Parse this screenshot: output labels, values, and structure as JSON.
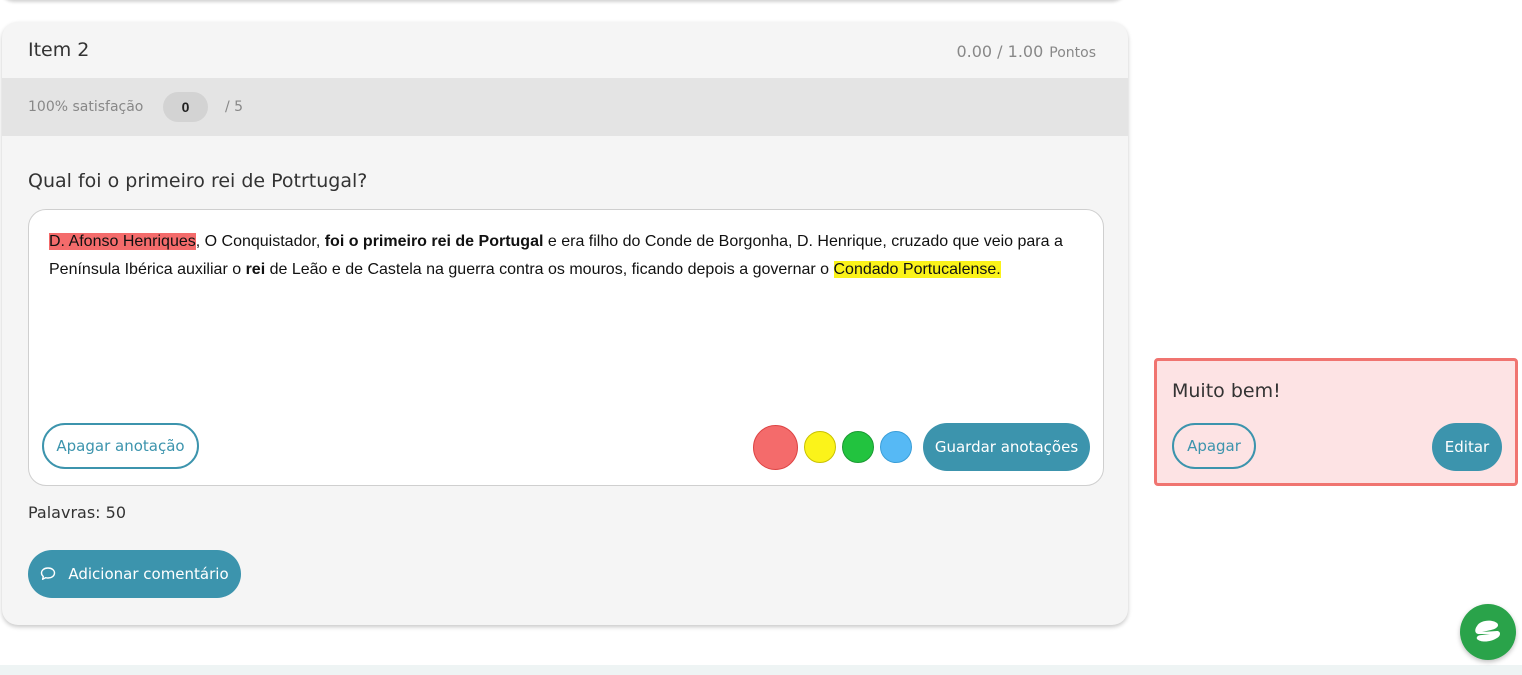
{
  "item": {
    "title": "Item 2",
    "score": "0.00 / 1.00",
    "score_unit": "Pontos",
    "satisfaction_label": "100% satisfação",
    "satisfaction_value": "0",
    "satisfaction_total": "/ 5",
    "question": "Qual foi o primeiro rei de Potrtugal?",
    "answer": {
      "segments": [
        {
          "text": "D. Afonso Henriques",
          "highlight": "red"
        },
        {
          "text": ", O Conquistador, "
        },
        {
          "text": "foi o primeiro rei de Portugal",
          "bold": true
        },
        {
          "text": " e era filho do Conde de Borgonha, D. Henrique, cruzado que veio para a Península Ibérica auxiliar o "
        },
        {
          "text": "rei",
          "bold": true
        },
        {
          "text": " de Leão e de Castela na guerra contra os mouros, ficando depois a governar o "
        },
        {
          "text": "Condado Portucalense.",
          "highlight": "yellow"
        }
      ]
    },
    "clear_annotation_label": "Apagar anotação",
    "save_annotations_label": "Guardar anotações",
    "highlight_colors": [
      "#f46b6b",
      "#fbf31a",
      "#22c33f",
      "#56b9f5"
    ],
    "word_count": "Palavras: 50",
    "add_comment_label": "Adicionar comentário"
  },
  "comment": {
    "text": "Muito bem!",
    "delete_label": "Apagar",
    "edit_label": "Editar"
  },
  "colors": {
    "accent": "#3c94ad",
    "comment_border": "#f07470",
    "comment_bg": "#fde3e4",
    "help_bubble": "#2aa34a"
  },
  "icons": {
    "comment": "speech-bubble-icon",
    "help": "support-hand-icon"
  }
}
